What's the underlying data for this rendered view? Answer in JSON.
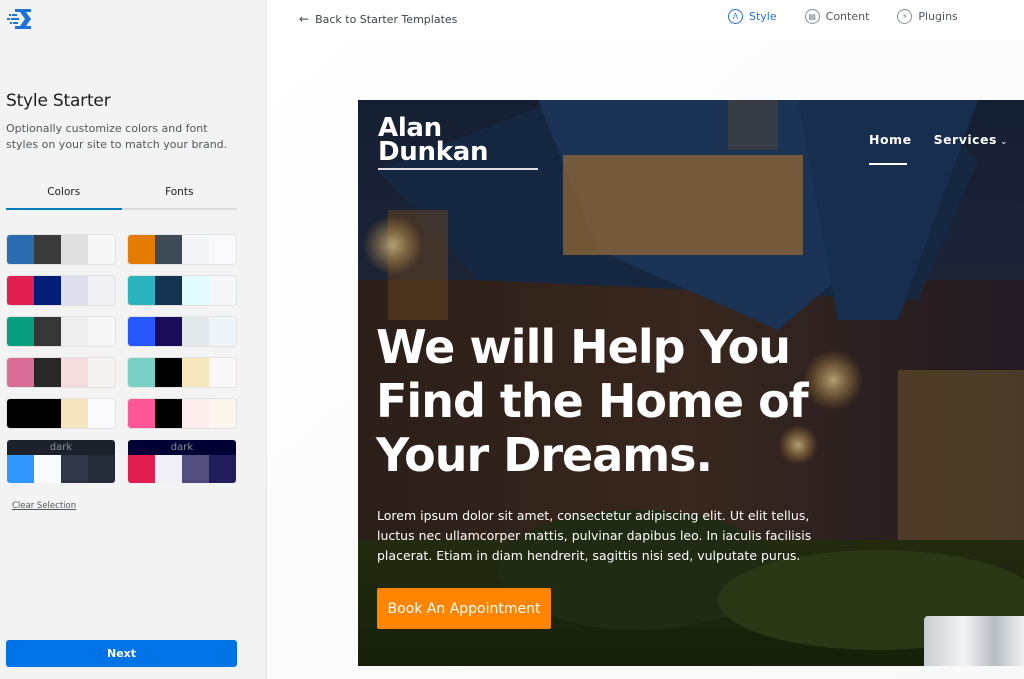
{
  "sidebar": {
    "logo_icon": "kadence-logo-icon",
    "title": "Style Starter",
    "description": "Optionally customize colors and font styles on your site to match your brand.",
    "tabs": [
      {
        "label": "Colors",
        "active": true
      },
      {
        "label": "Fonts",
        "active": false
      }
    ],
    "palettes": [
      {
        "name": "palette-1",
        "colors": [
          "#2b6cb0",
          "#3a3a3a",
          "#e0e0e0",
          "#f7f7f7"
        ]
      },
      {
        "name": "palette-2",
        "colors": [
          "#e47b02",
          "#3e4a56",
          "#f3f4f7",
          "#f9f9fb"
        ]
      },
      {
        "name": "palette-3",
        "colors": [
          "#e21e51",
          "#031e79",
          "#dfdeec",
          "#f0f0f5"
        ]
      },
      {
        "name": "palette-4",
        "colors": [
          "#2bb3be",
          "#16344f",
          "#e3fcff",
          "#f6f7fa"
        ]
      },
      {
        "name": "palette-5",
        "colors": [
          "#069e7e",
          "#363636",
          "#eeeeee",
          "#f7f7f7"
        ]
      },
      {
        "name": "palette-6",
        "colors": [
          "#2858fb",
          "#1b0c5a",
          "#e3e9ed",
          "#edf5f9"
        ]
      },
      {
        "name": "palette-7",
        "colors": [
          "#d86c97",
          "#282828",
          "#f7dede",
          "#f6f2ef"
        ]
      },
      {
        "name": "palette-8",
        "colors": [
          "#7acfc4",
          "#000000",
          "#f6e7bc",
          "#f9f7f7"
        ]
      },
      {
        "name": "palette-9",
        "colors": [
          "#000000",
          "#000000",
          "#f5e6bf",
          "#f9f8fa"
        ]
      },
      {
        "name": "palette-10",
        "colors": [
          "#ff5698",
          "#000000",
          "#fdedec",
          "#fdf6ee"
        ]
      },
      {
        "name": "palette-dark-1",
        "label": "dark",
        "header": "#1c212b",
        "colors": [
          "#3296ff",
          "#f7fbff",
          "#2d3748",
          "#252c39"
        ]
      },
      {
        "name": "palette-dark-2",
        "label": "dark",
        "header": "#020035",
        "colors": [
          "#e21e51",
          "#f0eff6",
          "#514d7c",
          "#221e5b"
        ]
      }
    ],
    "clear_label": "Clear Selection",
    "next_label": "Next"
  },
  "topbar": {
    "back_label": "Back to Starter Templates",
    "steps": [
      {
        "label": "Style",
        "icon": "brush-icon",
        "glyph": "Λ",
        "active": true
      },
      {
        "label": "Content",
        "icon": "content-icon",
        "glyph": "▤",
        "active": false
      },
      {
        "label": "Plugins",
        "icon": "plug-icon",
        "glyph": "⚡",
        "active": false
      }
    ]
  },
  "preview": {
    "brand_line1": "Alan",
    "brand_line2": "Dunkan",
    "nav": [
      {
        "label": "Home",
        "active": true
      },
      {
        "label": "Services",
        "dropdown": true
      }
    ],
    "headline": [
      "We will Help You",
      "Find the Home of",
      "Your Dreams."
    ],
    "paragraph": "Lorem ipsum dolor sit amet, consectetur adipiscing elit. Ut elit tellus, luctus nec ullamcorper mattis, pulvinar dapibus leo. In iaculis facilisis placerat. Etiam in diam hendrerit, sagittis nisi sed, vulputate purus.",
    "cta_label": "Book An Appointment",
    "accent_color": "#ff8500"
  },
  "colors": {
    "primary_button": "#0073e6",
    "active_step": "#2271d6"
  }
}
